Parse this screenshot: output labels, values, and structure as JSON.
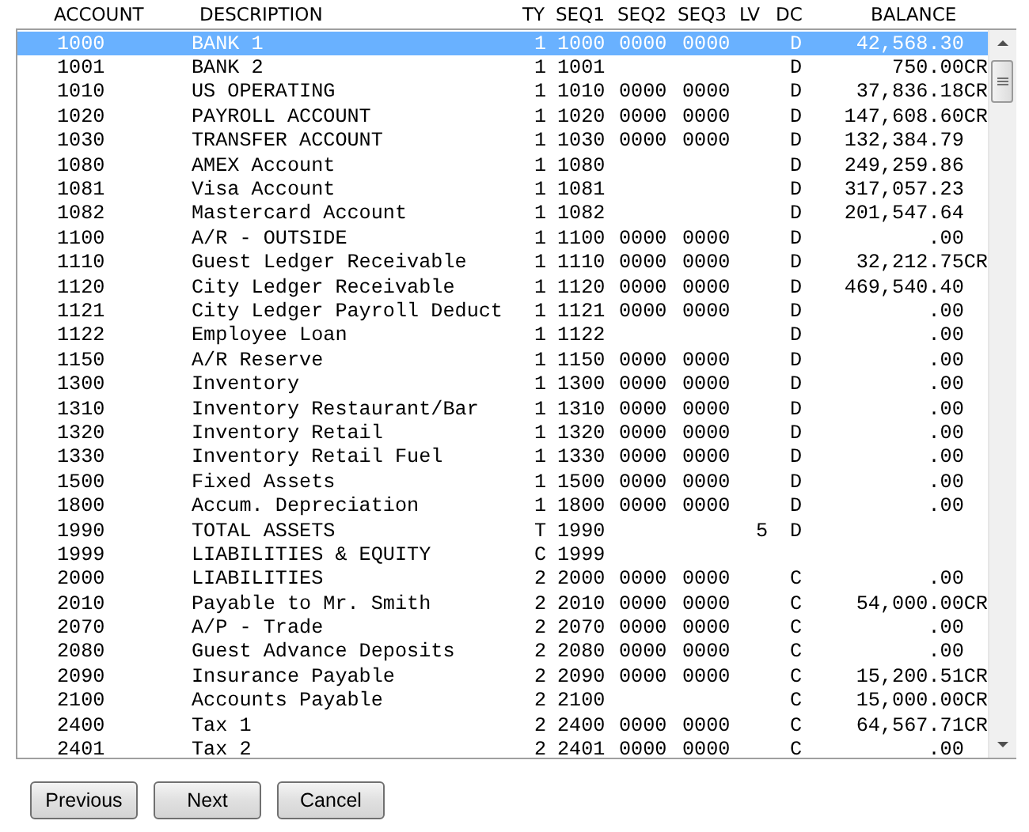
{
  "columns": [
    "ACCOUNT",
    "DESCRIPTION",
    "TY",
    "SEQ1",
    "SEQ2",
    "SEQ3",
    "LV",
    "DC",
    "BALANCE"
  ],
  "rows": [
    {
      "account": "1000",
      "description": "BANK 1",
      "ty": "1",
      "seq1": "1000",
      "seq2": "0000",
      "seq3": "0000",
      "lv": "",
      "dc": "D",
      "balance": "42,568.30",
      "selected": true
    },
    {
      "account": "1001",
      "description": "BANK 2",
      "ty": "1",
      "seq1": "1001",
      "seq2": "",
      "seq3": "",
      "lv": "",
      "dc": "D",
      "balance": "750.00CR",
      "selected": false
    },
    {
      "account": "1010",
      "description": "US OPERATING",
      "ty": "1",
      "seq1": "1010",
      "seq2": "0000",
      "seq3": "0000",
      "lv": "",
      "dc": "D",
      "balance": "37,836.18CR",
      "selected": false
    },
    {
      "account": "1020",
      "description": "PAYROLL ACCOUNT",
      "ty": "1",
      "seq1": "1020",
      "seq2": "0000",
      "seq3": "0000",
      "lv": "",
      "dc": "D",
      "balance": "147,608.60CR",
      "selected": false
    },
    {
      "account": "1030",
      "description": "TRANSFER ACCOUNT",
      "ty": "1",
      "seq1": "1030",
      "seq2": "0000",
      "seq3": "0000",
      "lv": "",
      "dc": "D",
      "balance": "132,384.79",
      "selected": false
    },
    {
      "account": "1080",
      "description": "AMEX Account",
      "ty": "1",
      "seq1": "1080",
      "seq2": "",
      "seq3": "",
      "lv": "",
      "dc": "D",
      "balance": "249,259.86",
      "selected": false
    },
    {
      "account": "1081",
      "description": "Visa Account",
      "ty": "1",
      "seq1": "1081",
      "seq2": "",
      "seq3": "",
      "lv": "",
      "dc": "D",
      "balance": "317,057.23",
      "selected": false
    },
    {
      "account": "1082",
      "description": "Mastercard Account",
      "ty": "1",
      "seq1": "1082",
      "seq2": "",
      "seq3": "",
      "lv": "",
      "dc": "D",
      "balance": "201,547.64",
      "selected": false
    },
    {
      "account": "1100",
      "description": "A/R - OUTSIDE",
      "ty": "1",
      "seq1": "1100",
      "seq2": "0000",
      "seq3": "0000",
      "lv": "",
      "dc": "D",
      "balance": ".00",
      "selected": false
    },
    {
      "account": "1110",
      "description": "Guest Ledger Receivable",
      "ty": "1",
      "seq1": "1110",
      "seq2": "0000",
      "seq3": "0000",
      "lv": "",
      "dc": "D",
      "balance": "32,212.75CR",
      "selected": false
    },
    {
      "account": "1120",
      "description": "City Ledger Receivable",
      "ty": "1",
      "seq1": "1120",
      "seq2": "0000",
      "seq3": "0000",
      "lv": "",
      "dc": "D",
      "balance": "469,540.40",
      "selected": false
    },
    {
      "account": "1121",
      "description": "City Ledger Payroll Deduct",
      "ty": "1",
      "seq1": "1121",
      "seq2": "0000",
      "seq3": "0000",
      "lv": "",
      "dc": "D",
      "balance": ".00",
      "selected": false
    },
    {
      "account": "1122",
      "description": "Employee Loan",
      "ty": "1",
      "seq1": "1122",
      "seq2": "",
      "seq3": "",
      "lv": "",
      "dc": "D",
      "balance": ".00",
      "selected": false
    },
    {
      "account": "1150",
      "description": "A/R Reserve",
      "ty": "1",
      "seq1": "1150",
      "seq2": "0000",
      "seq3": "0000",
      "lv": "",
      "dc": "D",
      "balance": ".00",
      "selected": false
    },
    {
      "account": "1300",
      "description": "Inventory",
      "ty": "1",
      "seq1": "1300",
      "seq2": "0000",
      "seq3": "0000",
      "lv": "",
      "dc": "D",
      "balance": ".00",
      "selected": false
    },
    {
      "account": "1310",
      "description": "Inventory Restaurant/Bar",
      "ty": "1",
      "seq1": "1310",
      "seq2": "0000",
      "seq3": "0000",
      "lv": "",
      "dc": "D",
      "balance": ".00",
      "selected": false
    },
    {
      "account": "1320",
      "description": "Inventory Retail",
      "ty": "1",
      "seq1": "1320",
      "seq2": "0000",
      "seq3": "0000",
      "lv": "",
      "dc": "D",
      "balance": ".00",
      "selected": false
    },
    {
      "account": "1330",
      "description": "Inventory Retail Fuel",
      "ty": "1",
      "seq1": "1330",
      "seq2": "0000",
      "seq3": "0000",
      "lv": "",
      "dc": "D",
      "balance": ".00",
      "selected": false
    },
    {
      "account": "1500",
      "description": "Fixed Assets",
      "ty": "1",
      "seq1": "1500",
      "seq2": "0000",
      "seq3": "0000",
      "lv": "",
      "dc": "D",
      "balance": ".00",
      "selected": false
    },
    {
      "account": "1800",
      "description": "Accum. Depreciation",
      "ty": "1",
      "seq1": "1800",
      "seq2": "0000",
      "seq3": "0000",
      "lv": "",
      "dc": "D",
      "balance": ".00",
      "selected": false
    },
    {
      "account": "1990",
      "description": "TOTAL ASSETS",
      "ty": "T",
      "seq1": "1990",
      "seq2": "",
      "seq3": "",
      "lv": "5",
      "dc": "D",
      "balance": "",
      "selected": false
    },
    {
      "account": "1999",
      "description": "LIABILITIES & EQUITY",
      "ty": "C",
      "seq1": "1999",
      "seq2": "",
      "seq3": "",
      "lv": "",
      "dc": "",
      "balance": "",
      "selected": false
    },
    {
      "account": "2000",
      "description": "LIABILITIES",
      "ty": "2",
      "seq1": "2000",
      "seq2": "0000",
      "seq3": "0000",
      "lv": "",
      "dc": "C",
      "balance": ".00",
      "selected": false
    },
    {
      "account": "2010",
      "description": "Payable to Mr. Smith",
      "ty": "2",
      "seq1": "2010",
      "seq2": "0000",
      "seq3": "0000",
      "lv": "",
      "dc": "C",
      "balance": "54,000.00CR",
      "selected": false
    },
    {
      "account": "2070",
      "description": "A/P - Trade",
      "ty": "2",
      "seq1": "2070",
      "seq2": "0000",
      "seq3": "0000",
      "lv": "",
      "dc": "C",
      "balance": ".00",
      "selected": false
    },
    {
      "account": "2080",
      "description": "Guest Advance Deposits",
      "ty": "2",
      "seq1": "2080",
      "seq2": "0000",
      "seq3": "0000",
      "lv": "",
      "dc": "C",
      "balance": ".00",
      "selected": false
    },
    {
      "account": "2090",
      "description": "Insurance Payable",
      "ty": "2",
      "seq1": "2090",
      "seq2": "0000",
      "seq3": "0000",
      "lv": "",
      "dc": "C",
      "balance": "15,200.51CR",
      "selected": false
    },
    {
      "account": "2100",
      "description": "Accounts Payable",
      "ty": "2",
      "seq1": "2100",
      "seq2": "",
      "seq3": "",
      "lv": "",
      "dc": "C",
      "balance": "15,000.00CR",
      "selected": false
    },
    {
      "account": "2400",
      "description": "Tax 1",
      "ty": "2",
      "seq1": "2400",
      "seq2": "0000",
      "seq3": "0000",
      "lv": "",
      "dc": "C",
      "balance": "64,567.71CR",
      "selected": false
    },
    {
      "account": "2401",
      "description": "Tax 2",
      "ty": "2",
      "seq1": "2401",
      "seq2": "0000",
      "seq3": "0000",
      "lv": "",
      "dc": "C",
      "balance": ".00",
      "selected": false
    }
  ],
  "buttons": [
    "Previous",
    "Next",
    "Cancel"
  ]
}
